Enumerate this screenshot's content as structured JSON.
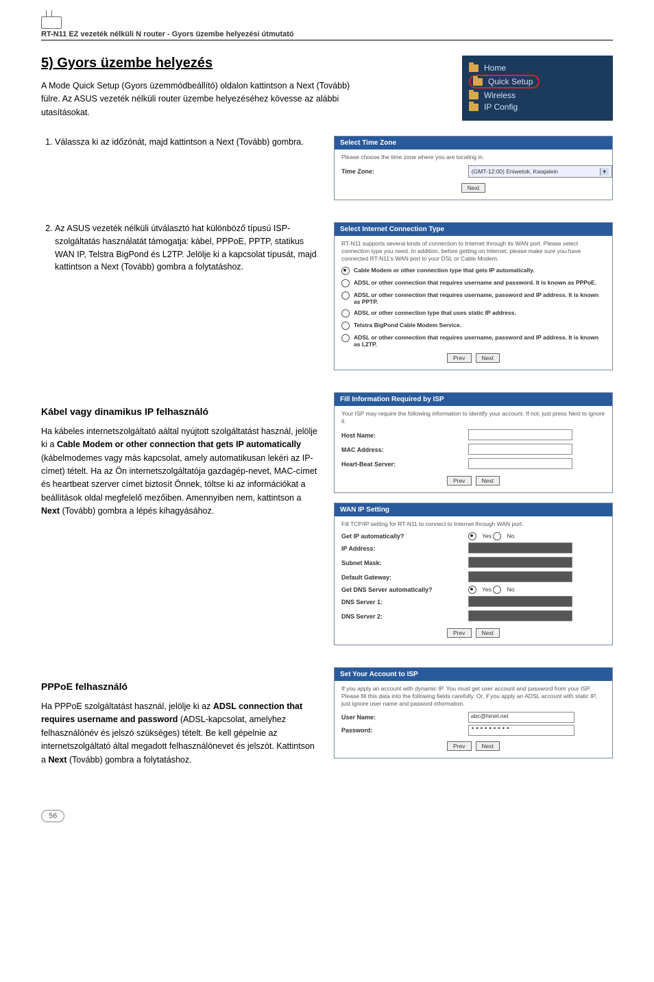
{
  "header": {
    "title": "RT-N11 EZ vezeték nélküli N router - Gyors üzembe helyezési útmutató"
  },
  "section": {
    "title": "5) Gyors üzembe helyezés"
  },
  "intro": "A Mode Quick Setup (Gyors üzemmódbeállító) oldalon kattintson a Next (Tovább) fülre. Az ASUS vezeték nélküli router üzembe helyezéséhez kövesse az alábbi utasításokat.",
  "nav": {
    "home": "Home",
    "quick": "Quick Setup",
    "wireless": "Wireless",
    "ip": "IP Config"
  },
  "steps": {
    "s1": "Válassza ki az időzónát, majd kattintson a Next (Tovább) gombra.",
    "s2": "Az ASUS vezeték nélküli útválasztó hat különböző típusú ISP-szolgáltatás használatát támogatja: kábel, PPPoE, PPTP, statikus WAN IP, Telstra BigPond és L2TP. Jelölje ki a kapcsolat típusát, majd kattintson a Next (Tovább) gombra a folytatáshoz."
  },
  "panels": {
    "time": {
      "header": "Select Time Zone",
      "desc": "Please choose the time zone where you are locating in.",
      "label": "Time Zone:",
      "value": "(GMT-12:00) Eniwetok, Kwajalein"
    },
    "conn": {
      "header": "Select Internet Connection Type",
      "desc": "RT-N11 supports several kinds of connection to Internet through its WAN port. Please select connection type you need. In addition, before getting on Internet, please make sure you have connected    RT-N11's WAN port to your DSL or Cable Modem.",
      "opt1": "Cable Modem or other connection type that gets IP automatically.",
      "opt2": "ADSL or other connection that requires username and password. It is known as PPPoE.",
      "opt3": "ADSL or other connection that requires username, password and IP address. It is known as PPTP.",
      "opt4": "ADSL or other connection type that uses static IP address.",
      "opt5": "Telstra BigPond Cable Modem Service.",
      "opt6": "ADSL or other connection that requires username, password and IP address. It is known as L2TP."
    },
    "isp": {
      "header": "Fill Information Required by ISP",
      "desc": "Your ISP may require the following information to identify your account. If not, just press Next to ignore it.",
      "host": "Host Name:",
      "mac": "MAC Address:",
      "heart": "Heart-Beat Server:"
    },
    "wan": {
      "header": "WAN IP Setting",
      "desc": "Fill TCP/IP setting for RT-N11 to connect to Internet through WAN port.",
      "getip": "Get IP automatically?",
      "ip": "IP Address:",
      "subnet": "Subnet Mask:",
      "gateway": "Default Gateway:",
      "getdns": "Get DNS Server automatically?",
      "dns1": "DNS Server 1:",
      "dns2": "DNS Server 2:",
      "yes": "Yes",
      "no": "No"
    },
    "account": {
      "header": "Set Your Account to ISP",
      "desc": "If you apply an account with dynamic IP. You must get user account and password from your ISP. Please fill this data into the following fields carefully. Or, if you apply an ADSL account with static IP, just ignore user name and pasword information.",
      "user": "User Name:",
      "pw": "Password:",
      "user_value": "abc@hinet.net",
      "pw_value": "•••••••••"
    }
  },
  "buttons": {
    "next": "Next",
    "prev": "Prev"
  },
  "cable": {
    "title": "Kábel vagy dinamikus IP felhasználó",
    "t1": "Ha kábeles internetszolgáltató aáltal nyújtott szolgáltatást használ, jelölje ki a ",
    "bold1": "Cable Modem or other connection that gets IP automatically",
    "t2": " (kábelmodemes vagy más kapcsolat, amely automatikusan lekéri az IP-címet) tételt. Ha az Ön internetszolgáltatója gazdagép-nevet, MAC-címet és heartbeat szerver címet biztosít Önnek, töltse ki az információkat a beállítások oldal megfelelő mezőiben. Amennyiben nem, kattintson a ",
    "bold2": "Next",
    "t3": " (Tovább) gombra a lépés kihagyásához."
  },
  "pppoe": {
    "title": "PPPoE felhasználó",
    "t1": "Ha PPPoE szolgáltatást használ, jelölje ki az ",
    "bold1": "ADSL connection that requires username and password",
    "t2": " (ADSL-kapcsolat, amelyhez felhasználónév és jelszó szükséges) tételt. Be kell gépelnie az internetszolgáltató által megadott felhasználónevet és jelszót. Kattintson a ",
    "bold2": "Next",
    "t3": " (Tovább) gombra a folytatáshoz."
  },
  "footer": {
    "page": "56"
  }
}
